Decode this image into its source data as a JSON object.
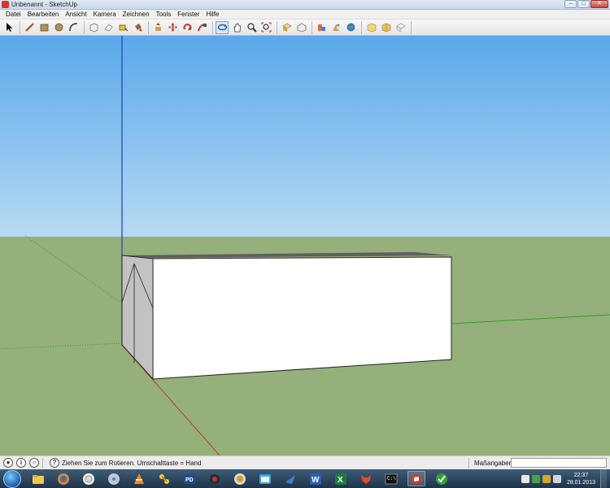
{
  "window": {
    "title": "Unbenannt - SketchUp",
    "controls": {
      "minimize": "–",
      "maximize": "□",
      "close": "✕"
    }
  },
  "menu": {
    "items": [
      {
        "label": "Datei"
      },
      {
        "label": "Bearbeiten"
      },
      {
        "label": "Ansicht"
      },
      {
        "label": "Kamera"
      },
      {
        "label": "Zeichnen"
      },
      {
        "label": "Tools"
      },
      {
        "label": "Fenster"
      },
      {
        "label": "Hilfe"
      }
    ]
  },
  "toolbar": {
    "groups": [
      [
        "select-icon"
      ],
      [
        "line-icon",
        "rectangle-icon",
        "circle-icon",
        "arc-icon"
      ],
      [
        "make-component-icon",
        "eraser-icon",
        "tape-measure-icon",
        "paint-bucket-icon"
      ],
      [
        "push-pull-icon",
        "move-icon",
        "rotate-icon",
        "follow-me-icon"
      ],
      [
        "orbit-icon",
        "pan-icon",
        "zoom-icon",
        "zoom-extents-icon"
      ],
      [
        "3d-warehouse-icon",
        "share-model-icon"
      ],
      [
        "get-photo-texture-icon",
        "google-earth-icon",
        "place-model-icon"
      ],
      [
        "component-browser-icon",
        "share-component-icon",
        "extension-warehouse-icon"
      ]
    ],
    "active_tool": "orbit-icon"
  },
  "scene": {
    "sky_color": "#7fbcee",
    "ground_color": "#95b07b",
    "box_front_color": "#ffffff",
    "box_side_color": "#c0c0c0",
    "axis_red": "#c0392b",
    "axis_green": "#2e9e3a",
    "axis_blue": "#1f3fb0"
  },
  "status": {
    "hint": "Ziehen Sie zum Rotieren.  Umschalttaste = Hand",
    "measure_label": "Maßangaben",
    "measure_value": ""
  },
  "taskbar": {
    "apps": [
      "file-explorer-icon",
      "firefox-icon",
      "browser-icon",
      "media-disc-icon",
      "vlc-icon",
      "network-app-icon",
      "pd-app-icon",
      "red-app-icon",
      "shield-app-icon",
      "window-app-icon",
      "blue-app-icon",
      "word-icon",
      "excel-icon",
      "fox-app-icon",
      "terminal-icon",
      "sketchup-icon",
      "green-app-icon"
    ],
    "active_app": "sketchup-icon",
    "time": "22:37",
    "date": "28.01.2013"
  }
}
